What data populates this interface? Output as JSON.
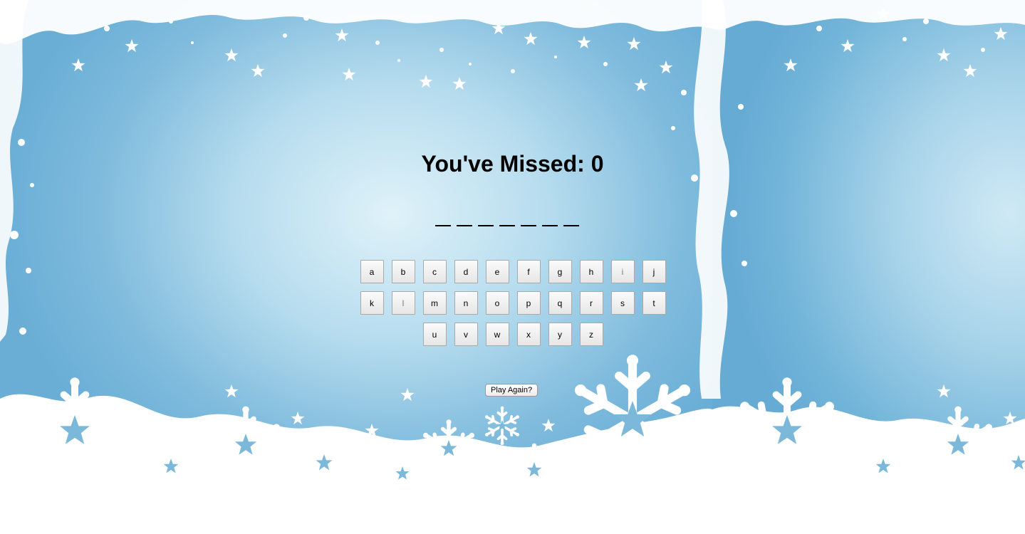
{
  "game": {
    "missed_label": "You've Missed: 0",
    "word_slots": [
      "",
      "",
      "",
      "",
      "",
      "",
      ""
    ],
    "keyboard_rows": [
      [
        "a",
        "b",
        "c",
        "d",
        "e",
        "f",
        "g",
        "h",
        "i",
        "j"
      ],
      [
        "k",
        "l",
        "m",
        "n",
        "o",
        "p",
        "q",
        "r",
        "s",
        "t"
      ],
      [
        "u",
        "v",
        "w",
        "x",
        "y",
        "z"
      ]
    ],
    "play_again_label": "Play Again?"
  },
  "theme": {
    "background": "#8fc3e0",
    "snow": "#ffffff"
  }
}
